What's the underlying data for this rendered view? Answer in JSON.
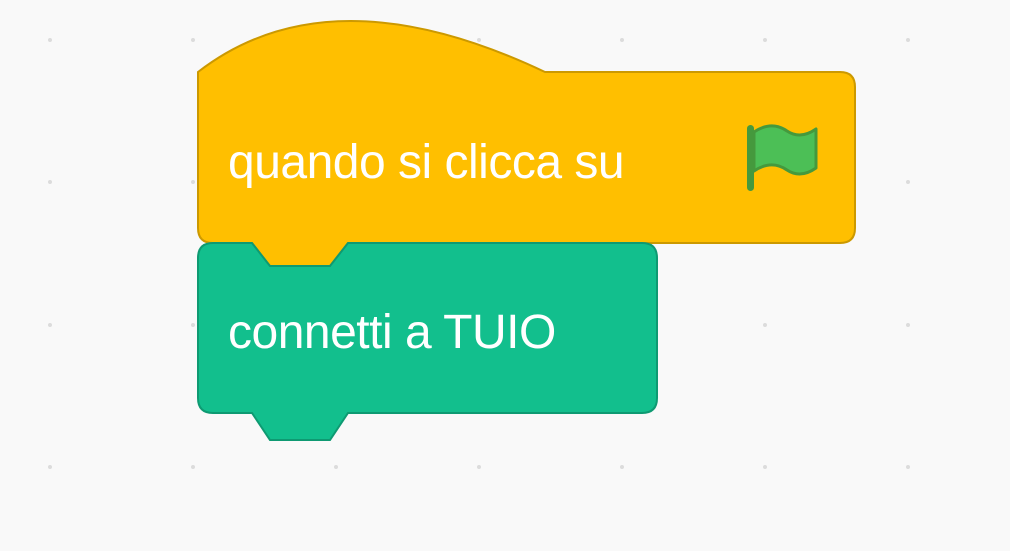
{
  "workspace": {
    "background": "#f9f9f9",
    "grid_dot_color": "#dcdcdc"
  },
  "hat_block": {
    "label": "quando si clicca su",
    "icon": "green-flag-icon",
    "fill": "#ffbf00",
    "stroke": "#cc9900",
    "flag_color": "#4cbf56",
    "flag_stroke": "#45993d"
  },
  "stack_block": {
    "label": "connetti a TUIO",
    "fill": "#12bf8d",
    "stroke": "#0e9a72"
  }
}
